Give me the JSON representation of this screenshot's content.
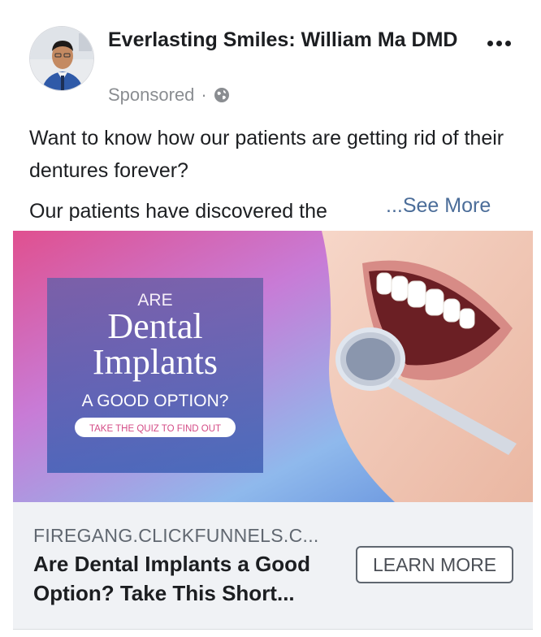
{
  "post": {
    "page_name": "Everlasting Smiles: William Ma DMD",
    "sponsored_label": "Sponsored",
    "separator": "·",
    "visibility_icon": "globe-icon",
    "more_icon": "more-options-icon",
    "body_line1": "Want to know how our patients are getting rid of their dentures forever?",
    "body_truncated": "Our patients have discovered the",
    "see_more": "...See More"
  },
  "ad_image": {
    "line1": "ARE",
    "line2": "Dental",
    "line3": "Implants",
    "line4": "A GOOD OPTION?",
    "pill": "TAKE THE QUIZ TO FIND OUT",
    "photo_subject": "smiling mouth with dental mirror"
  },
  "cta": {
    "domain": "FIREGANG.CLICKFUNNELS.C...",
    "headline": "Are Dental Implants a Good Option? Take This Short...",
    "button_label": "LEARN MORE"
  },
  "colors": {
    "link": "#4b6d99",
    "muted": "#8a8d91",
    "panel_bg": "#f0f2f5",
    "ad_pink": "#d95c9c",
    "ad_blue": "#3d70d0"
  }
}
